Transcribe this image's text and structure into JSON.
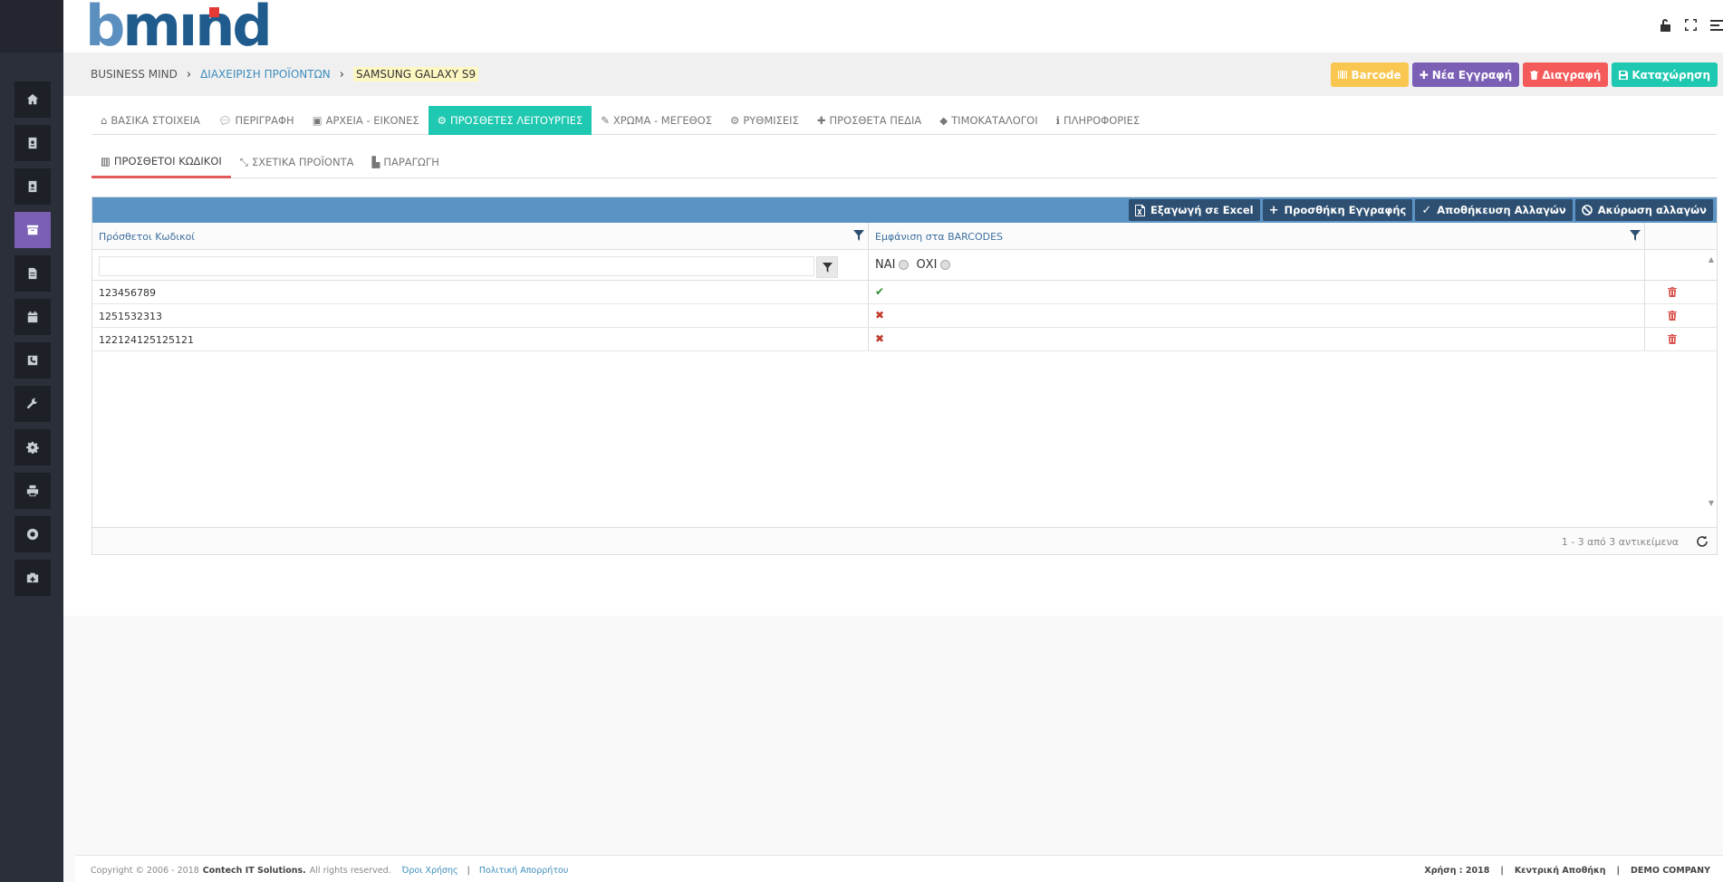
{
  "brand": {
    "logo_b": "b",
    "logo_rest": "mınd"
  },
  "breadcrumb": {
    "items": [
      "BUSINESS MIND",
      "ΔΙΑΧΕΙΡΙΣΗ ΠΡΟΪΟΝΤΩΝ",
      "SAMSUNG GALAXY S9"
    ],
    "separator": "›"
  },
  "actions": {
    "barcode": "Barcode",
    "new_record": "Νέα Εγγραφή",
    "delete": "Διαγραφή",
    "save": "Καταχώρηση"
  },
  "tabs": [
    {
      "label": "ΒΑΣΙΚΑ ΣΤΟΙΧΕΙΑ",
      "icon": "home-icon"
    },
    {
      "label": "ΠΕΡΙΓΡΑΦΗ",
      "icon": "comments-icon"
    },
    {
      "label": "ΑΡΧΕΙΑ - ΕΙΚΟΝΕΣ",
      "icon": "file-image-icon"
    },
    {
      "label": "ΠΡΟΣΘΕΤΕΣ ΛΕΙΤΟΥΡΓΙΕΣ",
      "icon": "cogs-icon",
      "active": true
    },
    {
      "label": "ΧΡΩΜΑ - ΜΕΓΕΘΟΣ",
      "icon": "brush-icon"
    },
    {
      "label": "ΡΥΘΜΙΣΕΙΣ",
      "icon": "gear-icon"
    },
    {
      "label": "ΠΡΟΣΘΕΤΑ ΠΕΔΙΑ",
      "icon": "plus-icon"
    },
    {
      "label": "ΤΙΜΟΚΑΤΑΛΟΓΟΙ",
      "icon": "tag-icon"
    },
    {
      "label": "ΠΛΗΡΟΦΟΡΙΕΣ",
      "icon": "info-icon"
    }
  ],
  "subtabs": [
    {
      "label": "ΠΡΟΣΘΕΤΟΙ ΚΩΔΙΚΟΙ",
      "icon": "barcode-icon",
      "active": true
    },
    {
      "label": "ΣΧΕΤΙΚΑ ΠΡΟΪΟΝΤΑ",
      "icon": "compress-icon"
    },
    {
      "label": "ΠΑΡΑΓΩΓΗ",
      "icon": "industry-icon"
    }
  ],
  "grid": {
    "toolbar": {
      "export_excel": "Εξαγωγή σε Excel",
      "add_record": "Προσθήκη Εγγραφής",
      "save_changes": "Αποθήκευση Αλλαγών",
      "cancel_changes": "Ακύρωση αλλαγών"
    },
    "columns": [
      "Πρόσθετοι Κωδικοί",
      "Εμφάνιση στα BARCODES"
    ],
    "filter": {
      "yes": "ΝΑΙ",
      "no": "ΟΧΙ",
      "placeholder": ""
    },
    "rows": [
      {
        "code": "123456789",
        "show_in_barcodes": true
      },
      {
        "code": "1251532313",
        "show_in_barcodes": false
      },
      {
        "code": "122124125125121",
        "show_in_barcodes": false
      }
    ],
    "pager": "1 - 3 από 3 αντικείμενα"
  },
  "footer": {
    "copyright": "Copyright © 2006 - 2018",
    "company": "Contech IT Solutions.",
    "rights": "All rights reserved.",
    "terms": "Όροι Χρήσης",
    "privacy": "Πολιτική Απορρήτου",
    "year": "Χρήση : 2018",
    "warehouse": "Κεντρική Αποθήκη",
    "demo": "DEMO COMPANY"
  },
  "colors": {
    "sidebar": "#2b2f3a",
    "accent_teal": "#1fc8b0",
    "accent_purple": "#7b5fb5",
    "accent_red": "#f45a5a",
    "accent_yellow": "#f9c74f",
    "grid_toolbar": "#5b93c4"
  }
}
